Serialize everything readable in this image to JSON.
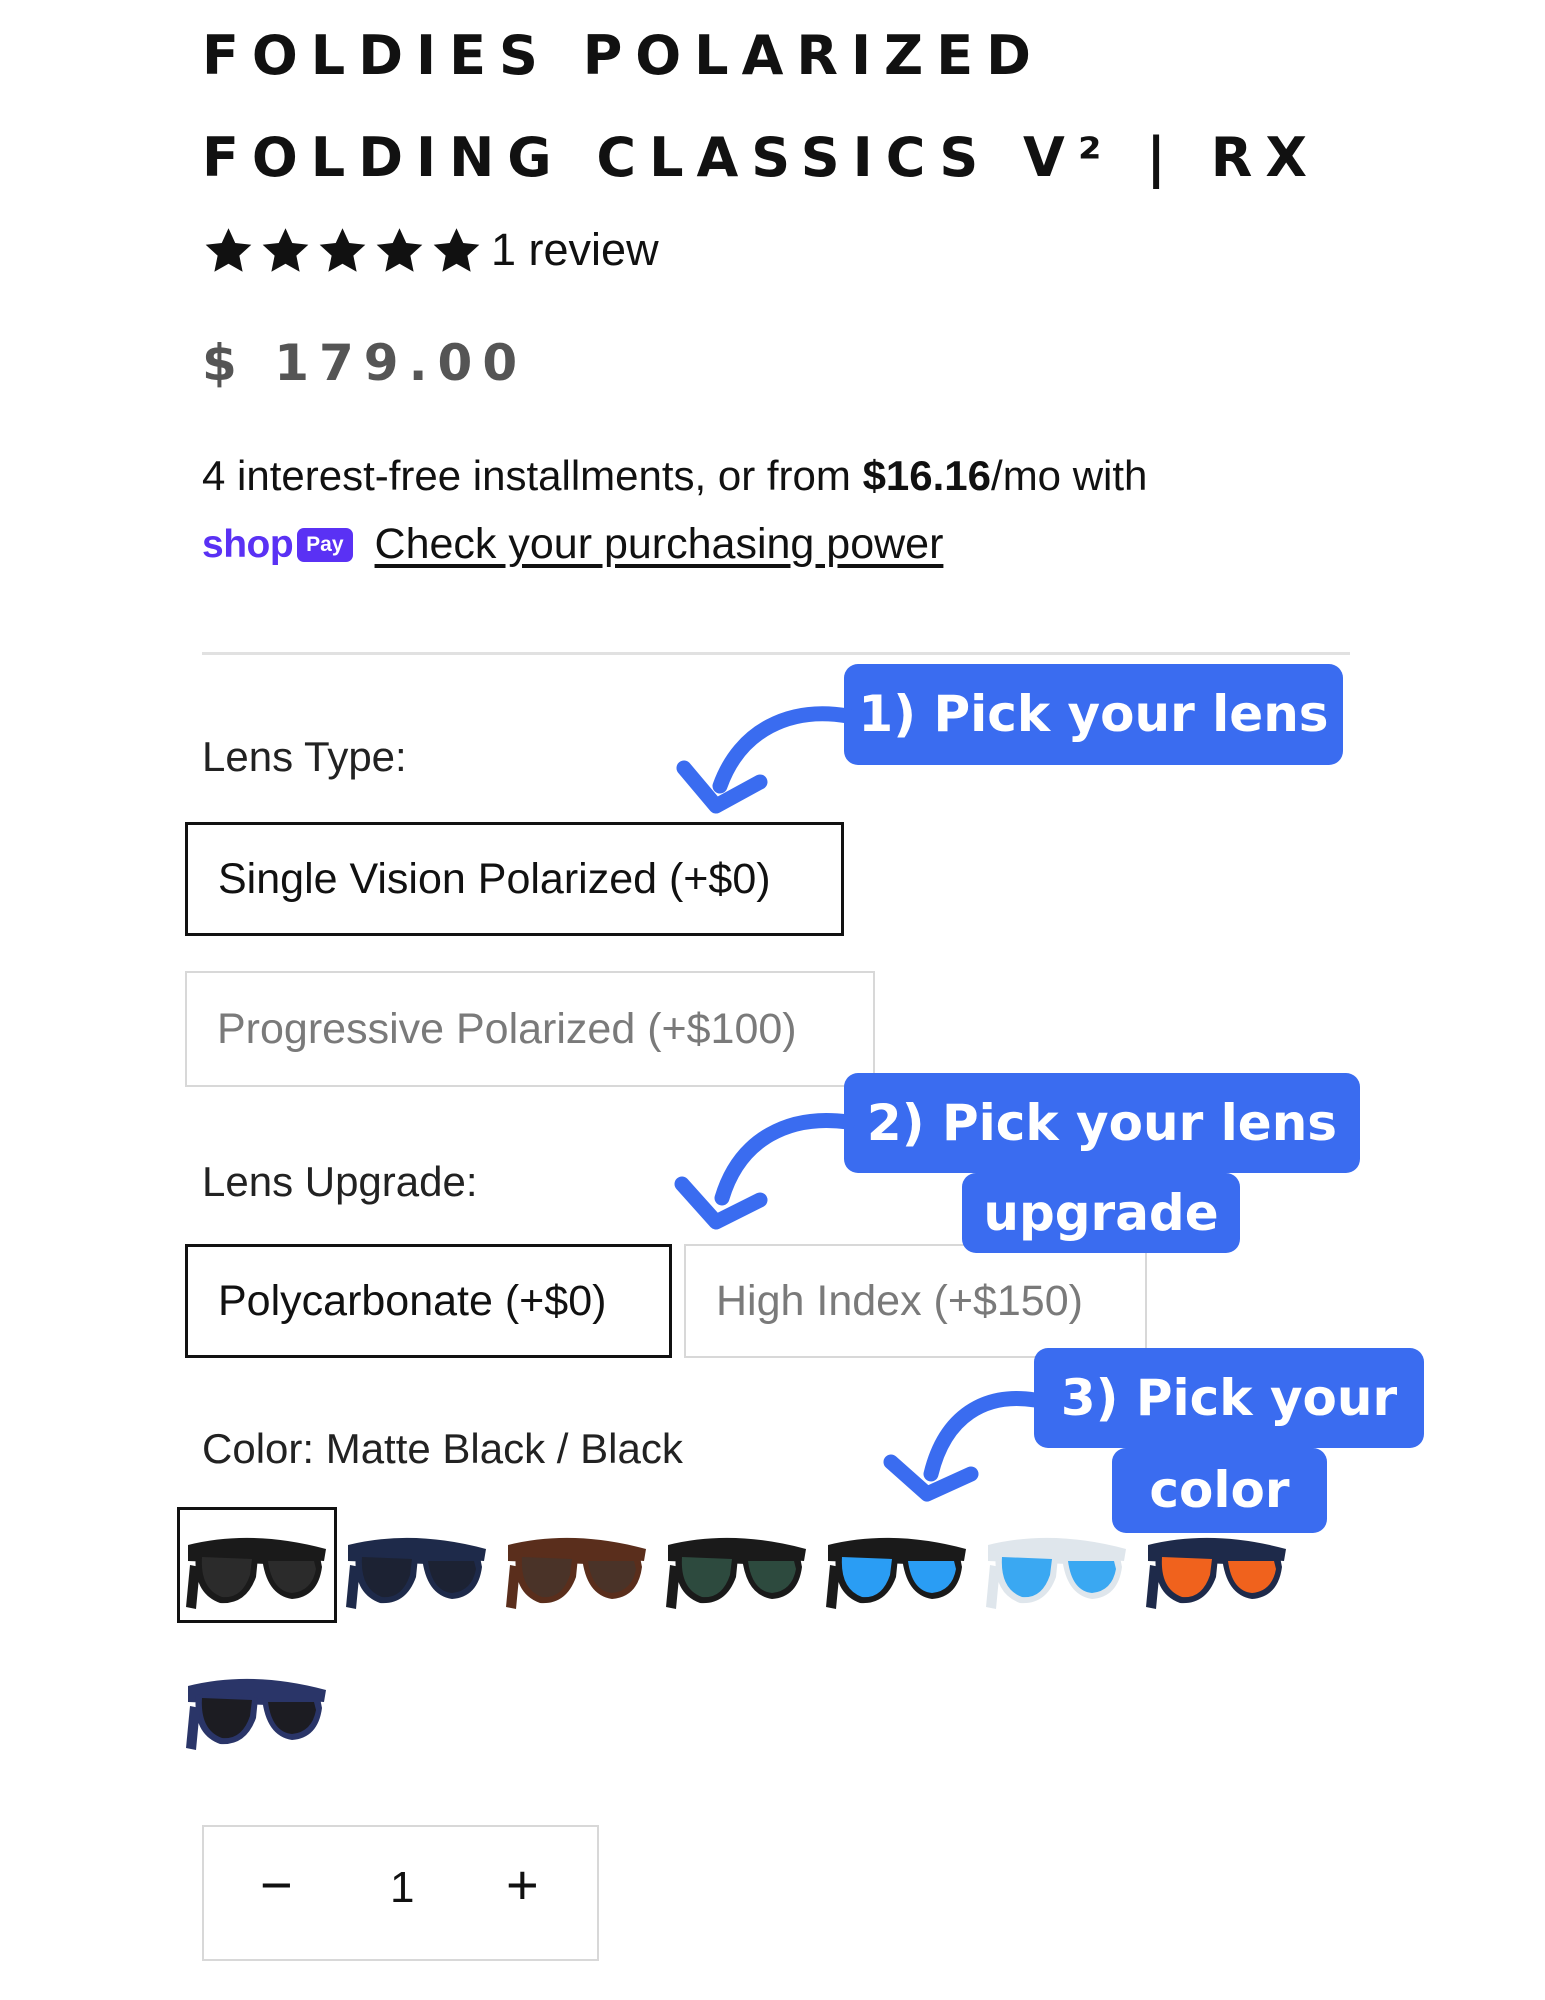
{
  "product": {
    "title_line1": "FOLDIES POLARIZED",
    "title_line2": "FOLDING CLASSICS V² | RX",
    "rating": 5,
    "rating_max": 5,
    "review_count": "1 review",
    "price": "$ 179.00"
  },
  "installments": {
    "text_before": "4 interest-free installments, or from ",
    "amount": "$16.16",
    "text_after": "/mo with",
    "shop_word": "shop",
    "pay_word": "Pay",
    "link": "Check your purchasing power"
  },
  "lens_type": {
    "label": "Lens Type:",
    "options": [
      {
        "label": "Single Vision Polarized (+$0)",
        "selected": true
      },
      {
        "label": "Progressive Polarized (+$100)",
        "selected": false
      }
    ]
  },
  "lens_upgrade": {
    "label": "Lens Upgrade:",
    "options": [
      {
        "label": "Polycarbonate (+$0)",
        "selected": true
      },
      {
        "label": "High Index (+$150)",
        "selected": false
      }
    ]
  },
  "color": {
    "label": "Color: Matte Black / Black",
    "swatches": [
      {
        "name": "sunglasses-matte-black",
        "frame": "#1a1a1a",
        "lens": "#2b2b2b",
        "selected": true
      },
      {
        "name": "sunglasses-navy",
        "frame": "#1e2a4a",
        "lens": "#1c2233",
        "selected": false
      },
      {
        "name": "sunglasses-tortoise-brown",
        "frame": "#5a2e1c",
        "lens": "#4a3328",
        "selected": false
      },
      {
        "name": "sunglasses-black-green",
        "frame": "#1a1a1a",
        "lens": "#2d4a3e",
        "selected": false
      },
      {
        "name": "sunglasses-black-blue-mirror",
        "frame": "#1a1a1a",
        "lens": "#2a9df4",
        "selected": false
      },
      {
        "name": "sunglasses-clear-blue-mirror",
        "frame": "#dfe6ec",
        "lens": "#3aa8f2",
        "selected": false
      },
      {
        "name": "sunglasses-navy-orange-mirror",
        "frame": "#1e2a4a",
        "lens": "#f0621d",
        "selected": false
      },
      {
        "name": "sunglasses-blue-black",
        "frame": "#2a3568",
        "lens": "#1c1c22",
        "selected": false
      }
    ]
  },
  "quantity": {
    "value": "1",
    "minus": "−",
    "plus": "+"
  },
  "callouts": {
    "step1": "1) Pick your lens",
    "step2_line1": "2) Pick your lens",
    "step2_line2": "upgrade",
    "step3_line1": "3) Pick your",
    "step3_line2": "color",
    "color": "#3a6cf0"
  }
}
